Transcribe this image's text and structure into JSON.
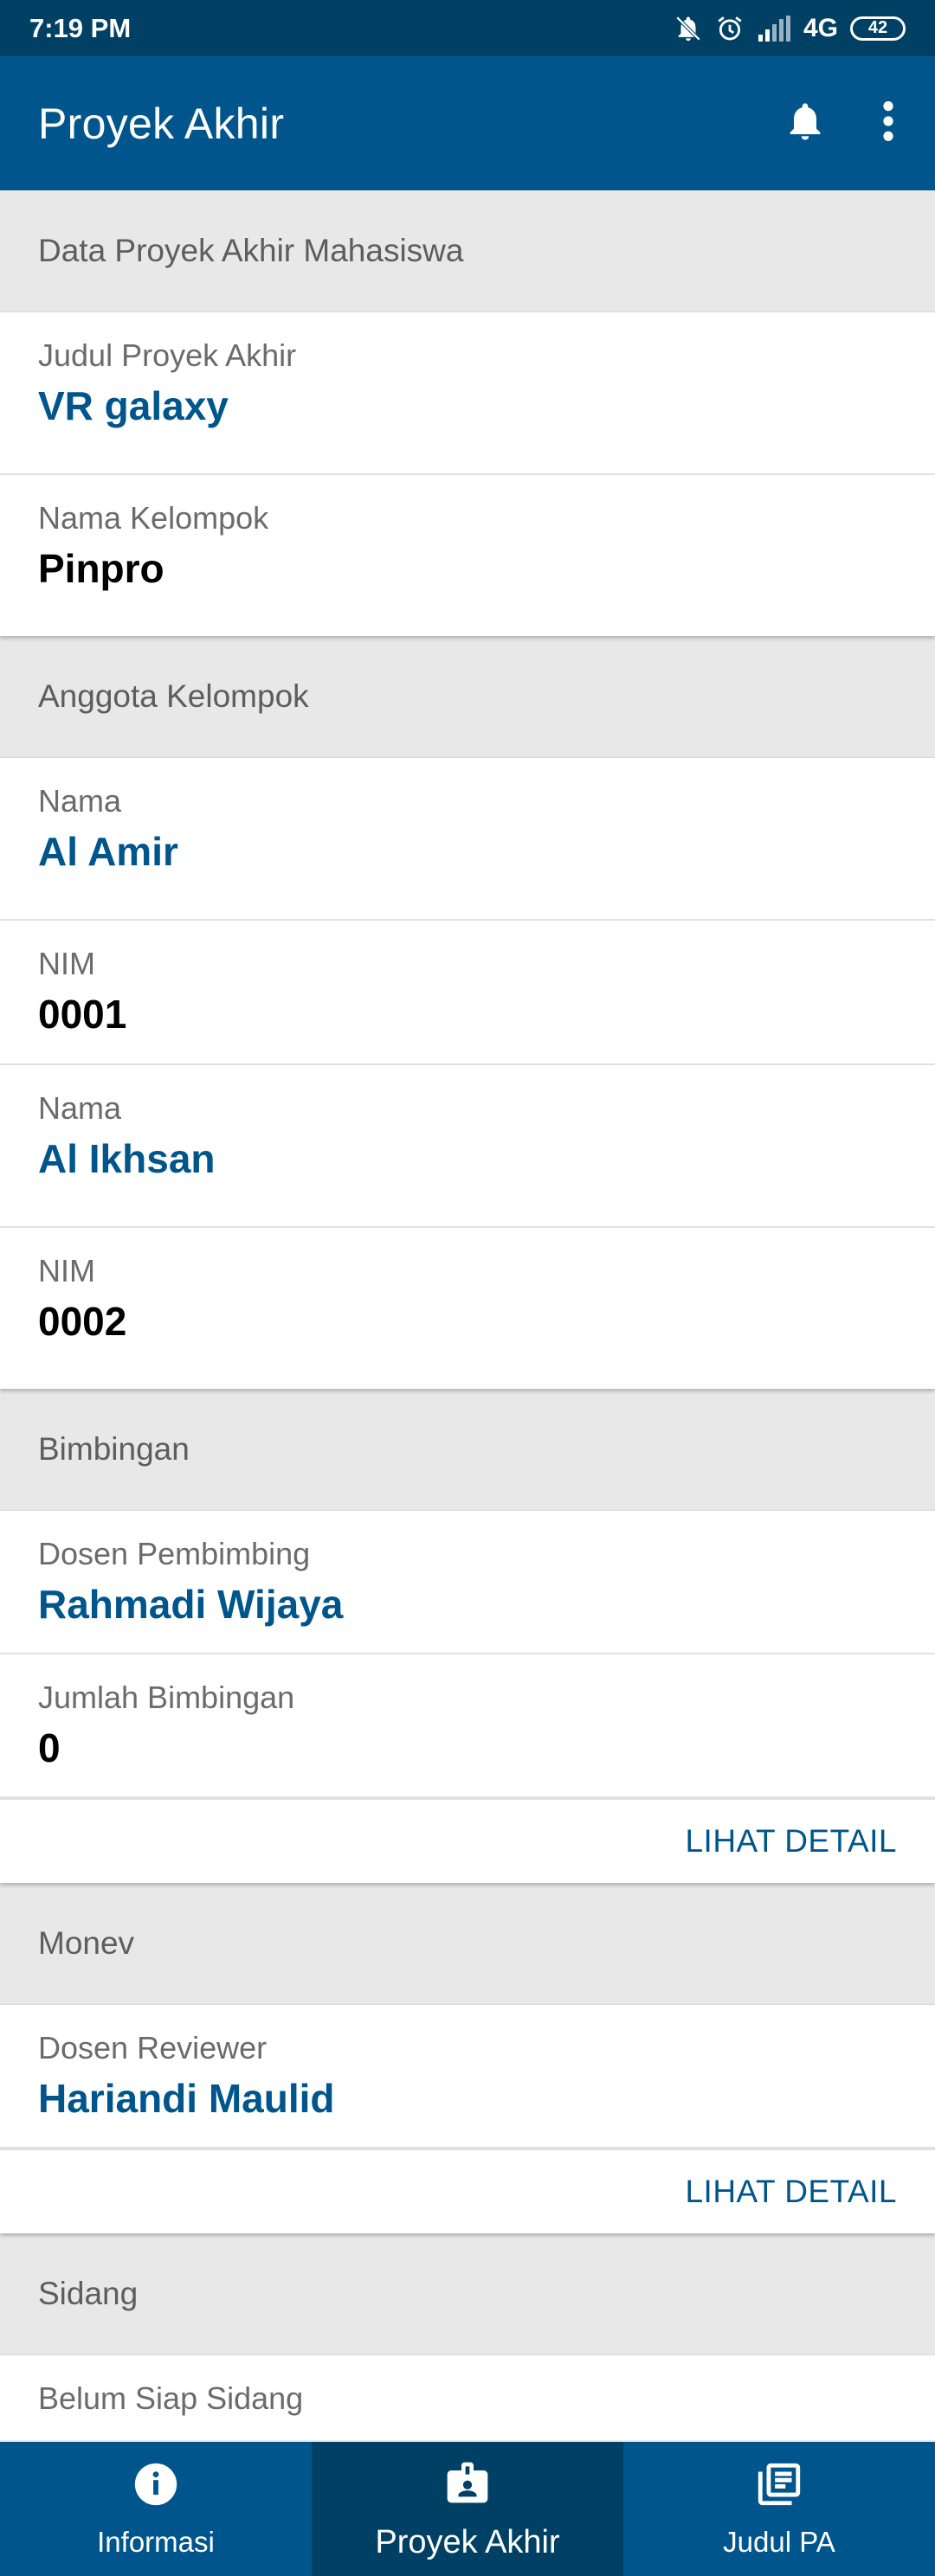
{
  "status_bar": {
    "time": "7:19 PM",
    "network": "4G",
    "battery": "42"
  },
  "app_bar": {
    "title": "Proyek Akhir",
    "icons": [
      "bell-icon",
      "more-vertical-icon"
    ]
  },
  "sections": {
    "data": {
      "header": "Data Proyek Akhir Mahasiswa",
      "judul_label": "Judul Proyek Akhir",
      "judul_value": "VR galaxy",
      "kelompok_label": "Nama Kelompok",
      "kelompok_value": "Pinpro"
    },
    "anggota": {
      "header": "Anggota Kelompok",
      "members": [
        {
          "nama_label": "Nama",
          "nama": "Al Amir",
          "nim_label": "NIM",
          "nim": "0001"
        },
        {
          "nama_label": "Nama",
          "nama": "Al Ikhsan",
          "nim_label": "NIM",
          "nim": "0002"
        }
      ]
    },
    "bimbingan": {
      "header": "Bimbingan",
      "dosen_label": "Dosen Pembimbing",
      "dosen_value": "Rahmadi Wijaya",
      "jumlah_label": "Jumlah Bimbingan",
      "jumlah_value": "0",
      "action": "LIHAT DETAIL"
    },
    "monev": {
      "header": "Monev",
      "reviewer_label": "Dosen Reviewer",
      "reviewer_value": "Hariandi Maulid",
      "action": "LIHAT DETAIL"
    },
    "sidang": {
      "header": "Sidang",
      "status_label": "Belum Siap Sidang"
    }
  },
  "bottom_nav": {
    "items": [
      {
        "label": "Informasi",
        "icon": "info-icon"
      },
      {
        "label": "Proyek Akhir",
        "icon": "badge-icon",
        "active": true
      },
      {
        "label": "Judul PA",
        "icon": "library-books-icon"
      }
    ]
  },
  "colors": {
    "primary": "#00568c",
    "primary_dark": "#004065",
    "background": "#e8e8e9"
  }
}
